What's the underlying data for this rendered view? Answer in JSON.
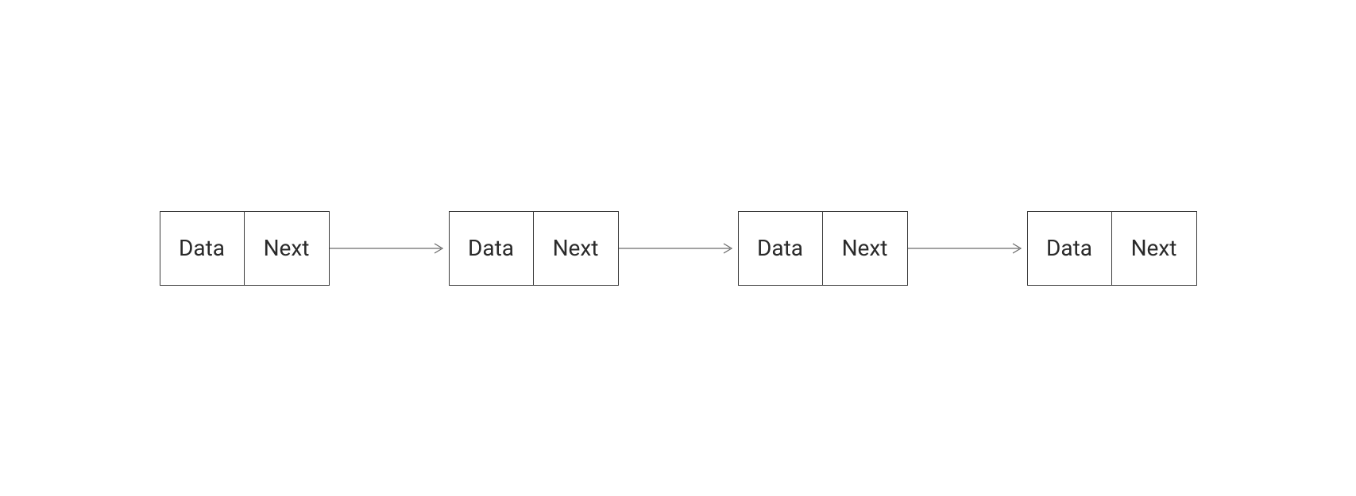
{
  "nodes": [
    {
      "data": "Data",
      "next": "Next"
    },
    {
      "data": "Data",
      "next": "Next"
    },
    {
      "data": "Data",
      "next": "Next"
    },
    {
      "data": "Data",
      "next": "Next"
    }
  ],
  "colors": {
    "border": "#3a3a3a",
    "text": "#2a2a2a",
    "arrow": "#6a6a6a"
  }
}
